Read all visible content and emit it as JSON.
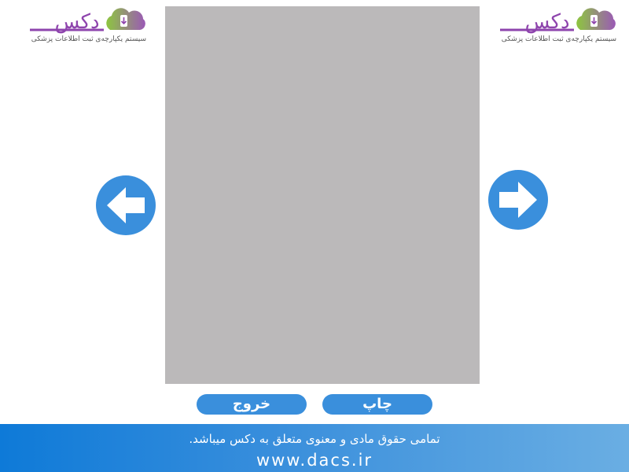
{
  "logo": {
    "wordmark": "دکس",
    "tagline": "سیستم یکپارچه‌ی ثبت اطلاعات پزشکی"
  },
  "viewer": {
    "state": "empty"
  },
  "nav": {
    "prev_icon": "arrow-left-icon",
    "next_icon": "arrow-right-icon"
  },
  "actions": {
    "print_label": "چاپ",
    "exit_label": "خروج"
  },
  "footer": {
    "copyright": "تمامی حقوق مادی و معنوی متعلق به دکس میباشد.",
    "website": "www.dacs.ir"
  },
  "colors": {
    "accent": "#3a8fdc",
    "viewer_bg": "#bbb9ba",
    "footer_start": "#0e7ad8",
    "footer_end": "#6aaee3",
    "brand_purple": "#8e44ad",
    "brand_green": "#8dc63f"
  }
}
